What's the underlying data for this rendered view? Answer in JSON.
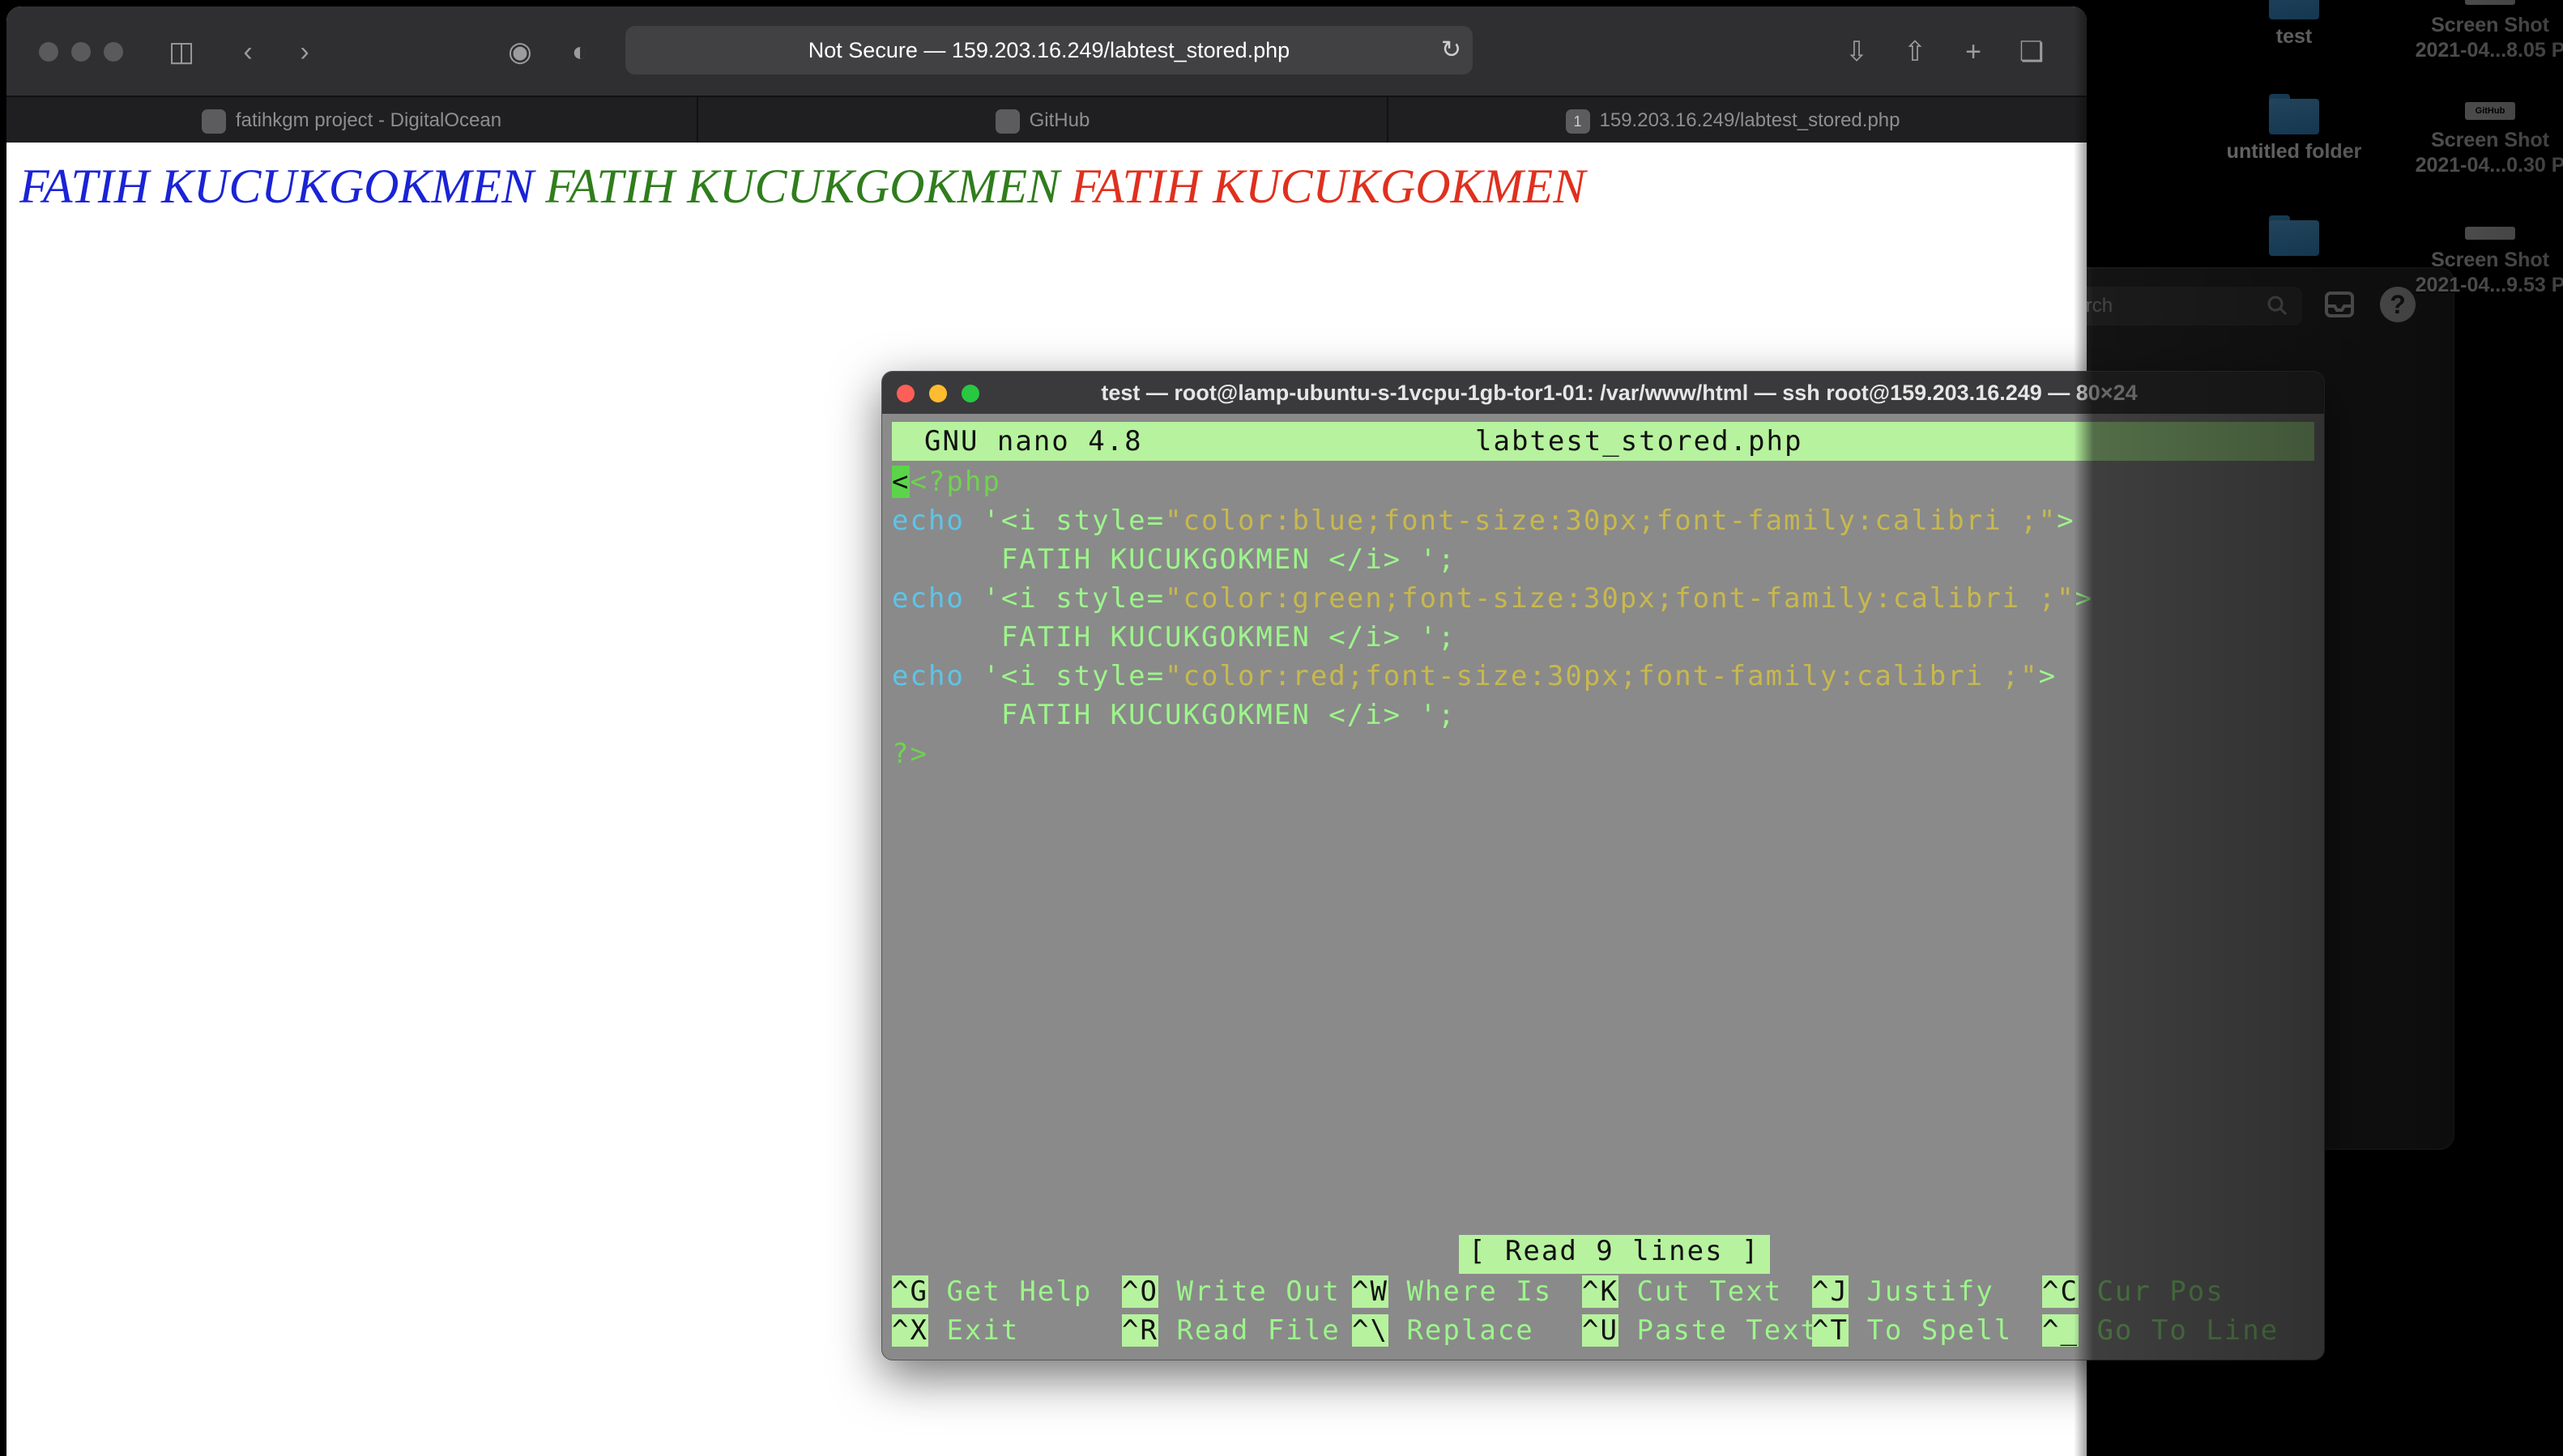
{
  "browser": {
    "address": "Not Secure — 159.203.16.249/labtest_stored.php",
    "tabs": [
      {
        "label": "fatihkgm project - DigitalOcean",
        "favicon": "digitalocean-icon"
      },
      {
        "label": "GitHub",
        "favicon": "github-icon"
      },
      {
        "label": "159.203.16.249/labtest_stored.php",
        "favicon": "1"
      }
    ],
    "page": {
      "lines": [
        {
          "text": "FATIH KUCUKGOKMEN",
          "color": "#1a23d6"
        },
        {
          "text": "FATIH KUCUKGOKMEN",
          "color": "#2f7d1c"
        },
        {
          "text": "FATIH KUCUKGOKMEN",
          "color": "#e0301e"
        }
      ]
    }
  },
  "terminal": {
    "title": "test — root@lamp-ubuntu-s-1vcpu-1gb-tor1-01: /var/www/html — ssh root@159.203.16.249 — 80×24",
    "nano_version": "GNU nano 4.8",
    "filename": "labtest_stored.php",
    "code": {
      "open": "<?php",
      "echo_kw": "echo",
      "lines": [
        {
          "a": " '<i style=",
          "b": "\"color:blue;font-size:30px;font-family:calibri ;\"",
          "c": ">"
        },
        {
          "a": " '<i style=",
          "b": "\"color:green;font-size:30px;font-family:calibri ;\"",
          "c": ">"
        },
        {
          "a": " '<i style=",
          "b": "\"color:red;font-size:30px;font-family:calibri ;\"",
          "c": ">"
        }
      ],
      "cont": "      FATIH KUCUKGOKMEN </i> ';",
      "close": "?>"
    },
    "status": "[ Read 9 lines ]",
    "shortcuts": [
      {
        "key": "^G",
        "label": "Get Help"
      },
      {
        "key": "^O",
        "label": "Write Out"
      },
      {
        "key": "^W",
        "label": "Where Is"
      },
      {
        "key": "^K",
        "label": "Cut Text"
      },
      {
        "key": "^J",
        "label": "Justify"
      },
      {
        "key": "^C",
        "label": "Cur Pos"
      },
      {
        "key": "^X",
        "label": "Exit"
      },
      {
        "key": "^R",
        "label": "Read File"
      },
      {
        "key": "^\\",
        "label": "Replace"
      },
      {
        "key": "^U",
        "label": "Paste Text"
      },
      {
        "key": "^T",
        "label": "To Spell"
      },
      {
        "key": "^_",
        "label": "Go To Line"
      }
    ]
  },
  "desktop": {
    "icons": [
      {
        "label": "test"
      },
      {
        "label": "Screen Shot\n2021-04...8.05 P"
      },
      {
        "label": "untitled folder"
      },
      {
        "label": "Screen Shot\n2021-04...0.30 P"
      },
      {
        "label": "Screen Shot\n2021-04...9.53 P"
      }
    ],
    "finder_search_placeholder": "Search",
    "github_thumb_text": "GitHub"
  }
}
